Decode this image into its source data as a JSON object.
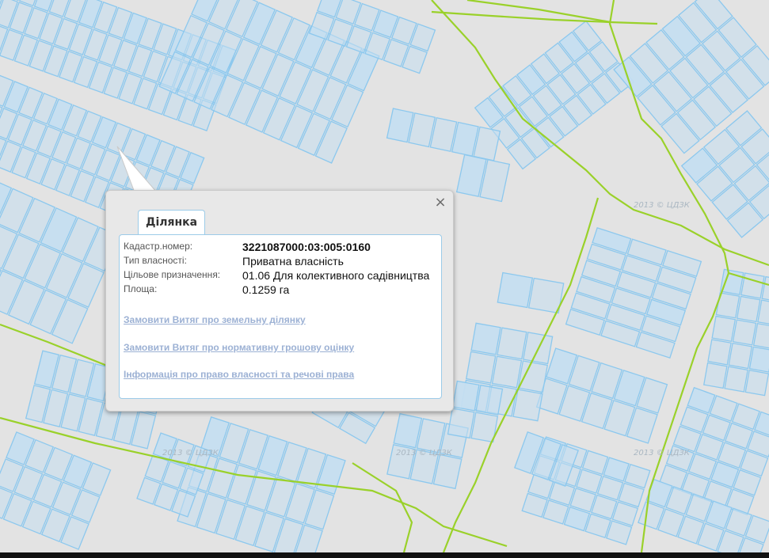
{
  "map": {
    "parcel_fill": "#c5def0",
    "parcel_stroke": "#8cc8ee",
    "boundary_color": "#9ad12a",
    "background": "#e3e3e3",
    "watermark": "2013 © ЦДЗК"
  },
  "popup": {
    "tab_label": "Ділянка",
    "close_glyph": "×",
    "fields": [
      {
        "label": "Кадастр.номер:",
        "value": "3221087000:03:005:0160"
      },
      {
        "label": "Тип власності:",
        "value": "Приватна власність"
      },
      {
        "label": "Цільове призначення:",
        "value": "01.06 Для колективного садівництва"
      },
      {
        "label": "Площа:",
        "value": "0.1259 га"
      }
    ],
    "links": [
      "Замовити Витяг про земельну ділянку",
      "Замовити Витяг про нормативну грошову оцінку",
      "Інформація про право власності та речові права"
    ]
  }
}
